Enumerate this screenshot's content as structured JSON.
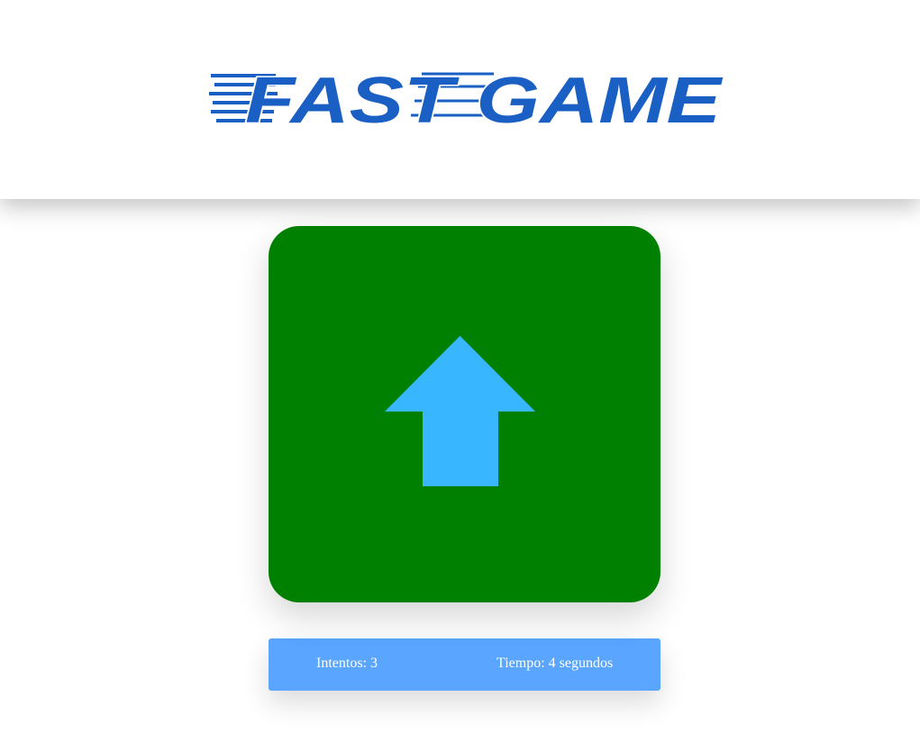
{
  "header": {
    "logo_text": "FAST GAME",
    "logo_color": "#1a5fc4"
  },
  "game": {
    "panel_color": "#008000",
    "arrow_direction": "up",
    "arrow_icon": "arrow-up-icon",
    "arrow_color": "#38b6ff"
  },
  "status": {
    "bar_color": "#59a5ff",
    "attempts_label": "Intentos: 3",
    "time_label": "Tiempo: 4 segundos"
  }
}
